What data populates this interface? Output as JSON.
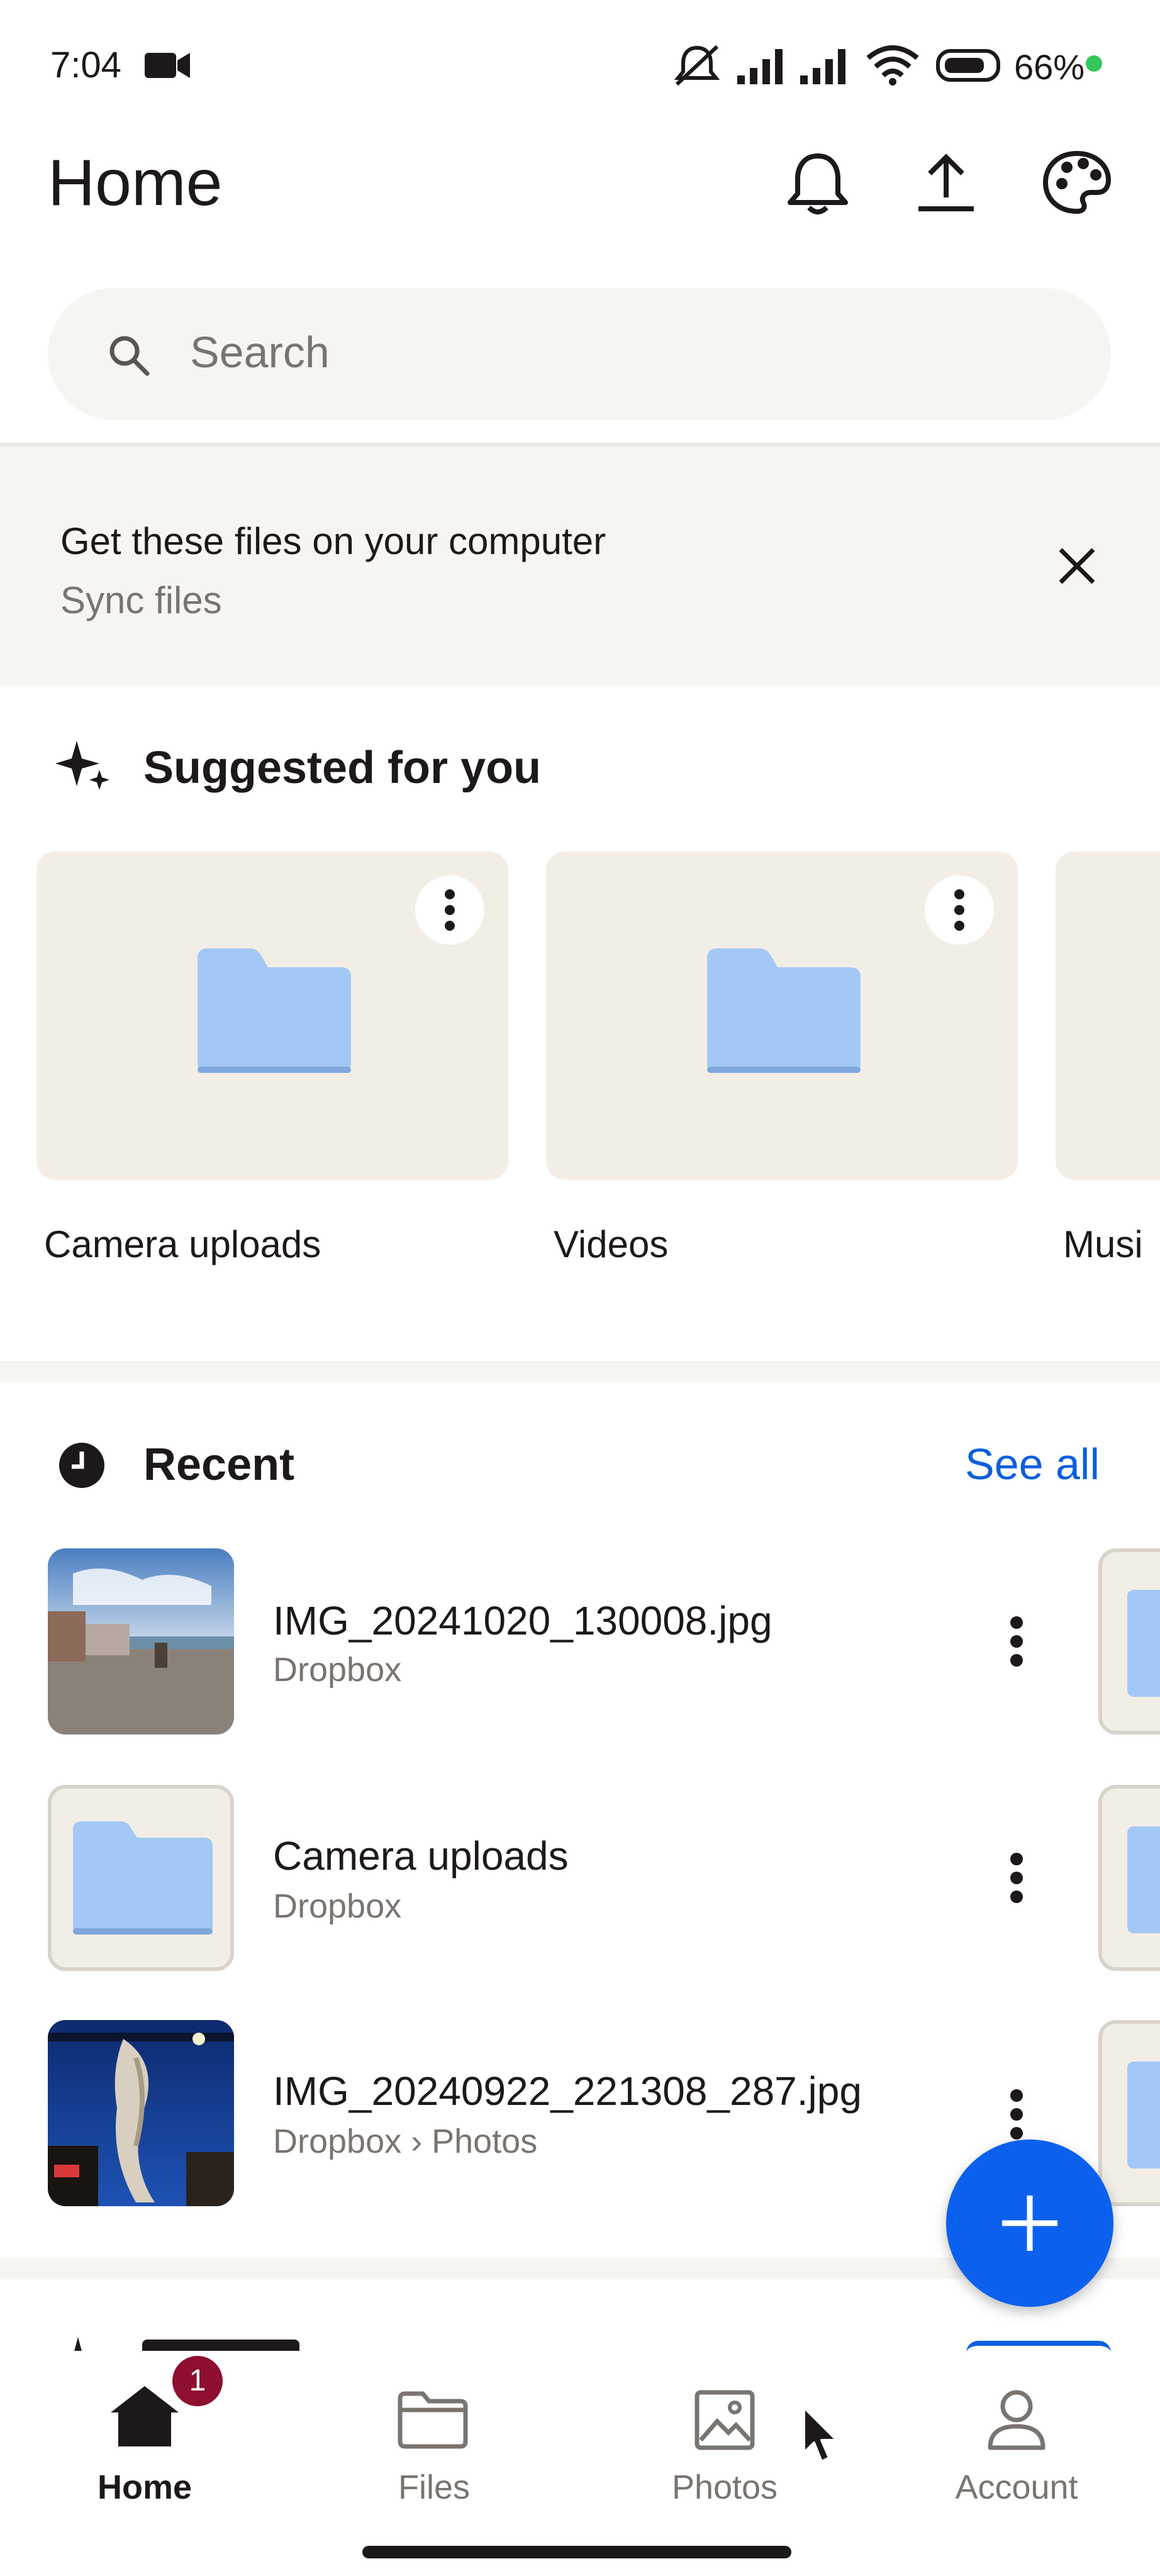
{
  "status_bar": {
    "time": "7:04",
    "battery": "66%",
    "icons": [
      "video-camera-icon",
      "mute-icon",
      "signal-icon",
      "signal-icon",
      "wifi-icon",
      "battery-icon"
    ]
  },
  "header": {
    "title": "Home",
    "actions": [
      "bell-icon",
      "upload-icon",
      "palette-icon"
    ]
  },
  "search": {
    "placeholder": "Search"
  },
  "banner": {
    "title": "Get these files on your computer",
    "subtitle": "Sync files"
  },
  "suggested": {
    "title": "Suggested for you",
    "cards": [
      {
        "label": "Camera uploads"
      },
      {
        "label": "Videos"
      },
      {
        "label": "Musi"
      }
    ]
  },
  "recent": {
    "title": "Recent",
    "see_all": "See all",
    "items": [
      {
        "name": "IMG_20241020_130008.jpg",
        "path": "Dropbox"
      },
      {
        "name": "Camera uploads",
        "path": "Dropbox"
      },
      {
        "name": "IMG_20240922_221308_287.jpg",
        "path": "Dropbox › Photos"
      }
    ]
  },
  "nav": {
    "badge": "1",
    "items": [
      {
        "label": "Home"
      },
      {
        "label": "Files"
      },
      {
        "label": "Photos"
      },
      {
        "label": "Account"
      }
    ]
  },
  "colors": {
    "accent": "#0b61ee",
    "link": "#0b5fde",
    "folder": "#a4c8f5",
    "badge": "#8e0f30"
  }
}
